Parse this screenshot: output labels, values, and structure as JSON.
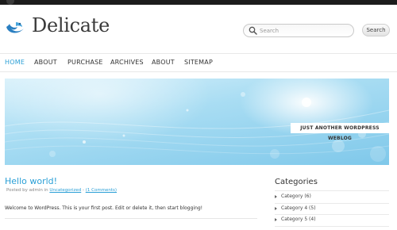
{
  "site": {
    "title": "Delicate",
    "tagline": "JUST ANOTHER WORDPRESS WEBLOG"
  },
  "search": {
    "placeholder": "Search",
    "button_label": "Search"
  },
  "nav": {
    "items": [
      {
        "label": "HOME",
        "active": true
      },
      {
        "label": "ABOUT",
        "active": false
      },
      {
        "label": "PURCHASE",
        "active": false
      },
      {
        "label": "ARCHIVES",
        "active": false
      },
      {
        "label": "ABOUT",
        "active": false
      },
      {
        "label": "SITEMAP",
        "active": false
      }
    ]
  },
  "post": {
    "title": "Hello world!",
    "meta_prefix": "Posted by admin in ",
    "category_link": "Uncategorized",
    "meta_separator": " - ",
    "comments_link": "(1 Comments)",
    "body": "Welcome to WordPress. This is your first post. Edit or delete it, then start blogging!"
  },
  "sidebar": {
    "title": "Categories",
    "categories": [
      {
        "label": "Category (6)"
      },
      {
        "label": "Category 4 (5)"
      },
      {
        "label": "Category 5 (4)"
      }
    ]
  },
  "colors": {
    "accent": "#2a9fd6",
    "topbar": "#1c1c1c",
    "banner": "#a9ddf3"
  },
  "icons": {
    "logo": "bird-logo-icon",
    "search": "search-icon",
    "category_bullet": "triangle-right-icon"
  }
}
